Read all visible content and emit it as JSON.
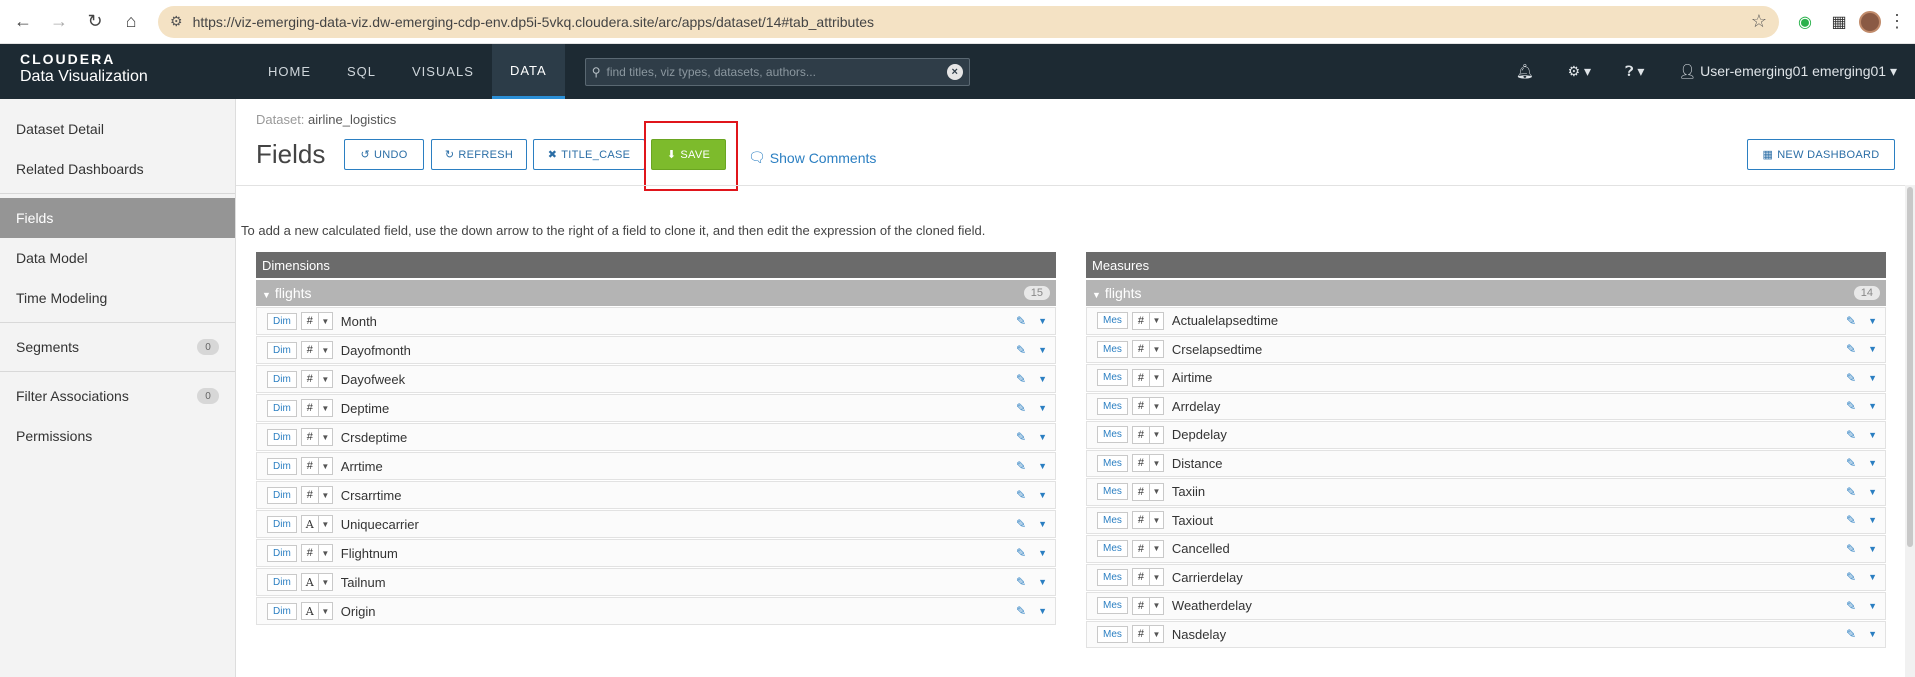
{
  "browser": {
    "url": "https://viz-emerging-data-viz.dw-emerging-cdp-env.dp5i-5vkq.cloudera.site/arc/apps/dataset/14#tab_attributes"
  },
  "app": {
    "brand_top": "CLOUDERA",
    "brand_bottom": "Data Visualization",
    "nav": [
      "HOME",
      "SQL",
      "VISUALS",
      "DATA"
    ],
    "active_nav": "DATA",
    "search_placeholder": "find titles, viz types, datasets, authors...",
    "user_label": "User-emerging01 emerging01"
  },
  "sidebar": {
    "items": [
      {
        "label": "Dataset Detail"
      },
      {
        "label": "Related Dashboards"
      },
      {
        "label": "Fields"
      },
      {
        "label": "Data Model"
      },
      {
        "label": "Time Modeling"
      },
      {
        "label": "Segments",
        "badge": "0"
      },
      {
        "label": "Filter Associations",
        "badge": "0"
      },
      {
        "label": "Permissions"
      }
    ]
  },
  "page": {
    "dataset_label": "Dataset:",
    "dataset_name": "airline_logistics",
    "title": "Fields",
    "undo": "UNDO",
    "refresh": "REFRESH",
    "title_case": "TITLE_CASE",
    "save": "SAVE",
    "show_comments": "Show Comments",
    "new_dashboard": "NEW DASHBOARD",
    "help_text": "To add a new calculated field, use the down arrow to the right of a field to clone it, and then edit the expression of the cloned field."
  },
  "dimensions": {
    "title": "Dimensions",
    "group": "flights",
    "count": "15",
    "rows": [
      {
        "tag": "Dim",
        "type": "#",
        "name": "Month"
      },
      {
        "tag": "Dim",
        "type": "#",
        "name": "Dayofmonth"
      },
      {
        "tag": "Dim",
        "type": "#",
        "name": "Dayofweek"
      },
      {
        "tag": "Dim",
        "type": "#",
        "name": "Deptime"
      },
      {
        "tag": "Dim",
        "type": "#",
        "name": "Crsdeptime"
      },
      {
        "tag": "Dim",
        "type": "#",
        "name": "Arrtime"
      },
      {
        "tag": "Dim",
        "type": "#",
        "name": "Crsarrtime"
      },
      {
        "tag": "Dim",
        "type": "A",
        "name": "Uniquecarrier"
      },
      {
        "tag": "Dim",
        "type": "#",
        "name": "Flightnum"
      },
      {
        "tag": "Dim",
        "type": "A",
        "name": "Tailnum"
      },
      {
        "tag": "Dim",
        "type": "A",
        "name": "Origin"
      }
    ]
  },
  "measures": {
    "title": "Measures",
    "group": "flights",
    "count": "14",
    "rows": [
      {
        "tag": "Mes",
        "type": "#",
        "name": "Actualelapsedtime"
      },
      {
        "tag": "Mes",
        "type": "#",
        "name": "Crselapsedtime"
      },
      {
        "tag": "Mes",
        "type": "#",
        "name": "Airtime"
      },
      {
        "tag": "Mes",
        "type": "#",
        "name": "Arrdelay"
      },
      {
        "tag": "Mes",
        "type": "#",
        "name": "Depdelay"
      },
      {
        "tag": "Mes",
        "type": "#",
        "name": "Distance"
      },
      {
        "tag": "Mes",
        "type": "#",
        "name": "Taxiin"
      },
      {
        "tag": "Mes",
        "type": "#",
        "name": "Taxiout"
      },
      {
        "tag": "Mes",
        "type": "#",
        "name": "Cancelled"
      },
      {
        "tag": "Mes",
        "type": "#",
        "name": "Carrierdelay"
      },
      {
        "tag": "Mes",
        "type": "#",
        "name": "Weatherdelay"
      },
      {
        "tag": "Mes",
        "type": "#",
        "name": "Nasdelay"
      }
    ]
  }
}
